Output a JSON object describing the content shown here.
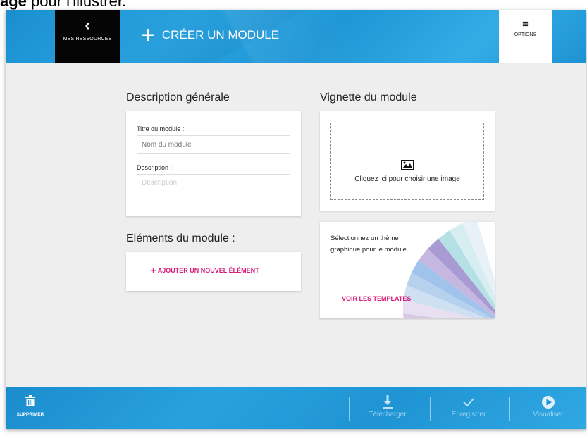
{
  "caption": {
    "bold": "age",
    "rest": " pour l'illustrer."
  },
  "topbar": {
    "back_label": "MES RESSOURCES",
    "title": "CRÉER UN MODULE",
    "options_label": "OPTIONS"
  },
  "general": {
    "title": "Description générale",
    "module_title_label": "Titre du module :",
    "module_title_placeholder": "Nom du module",
    "description_label": "Description :",
    "description_placeholder": "Description"
  },
  "thumbnail": {
    "title": "Vignette du module",
    "choose_text": "Cliquez ici pour choisir une image"
  },
  "elements": {
    "title": "Eléments du module :",
    "add_label": "AJOUTER UN NOUVEL ÉLÉMENT"
  },
  "theme": {
    "text_line1": "Sélectionnez un thème",
    "text_line2": "graphique pour le module",
    "link_label": "VOIR LES TEMPLATES"
  },
  "bottombar": {
    "delete_label": "SUPPRIMER",
    "download_label": "Télécharger",
    "save_label": "Enregistrer",
    "preview_label": "Visualiser"
  },
  "colors": {
    "accent": "#d81b78",
    "brand_blue": "#1f96d6"
  }
}
